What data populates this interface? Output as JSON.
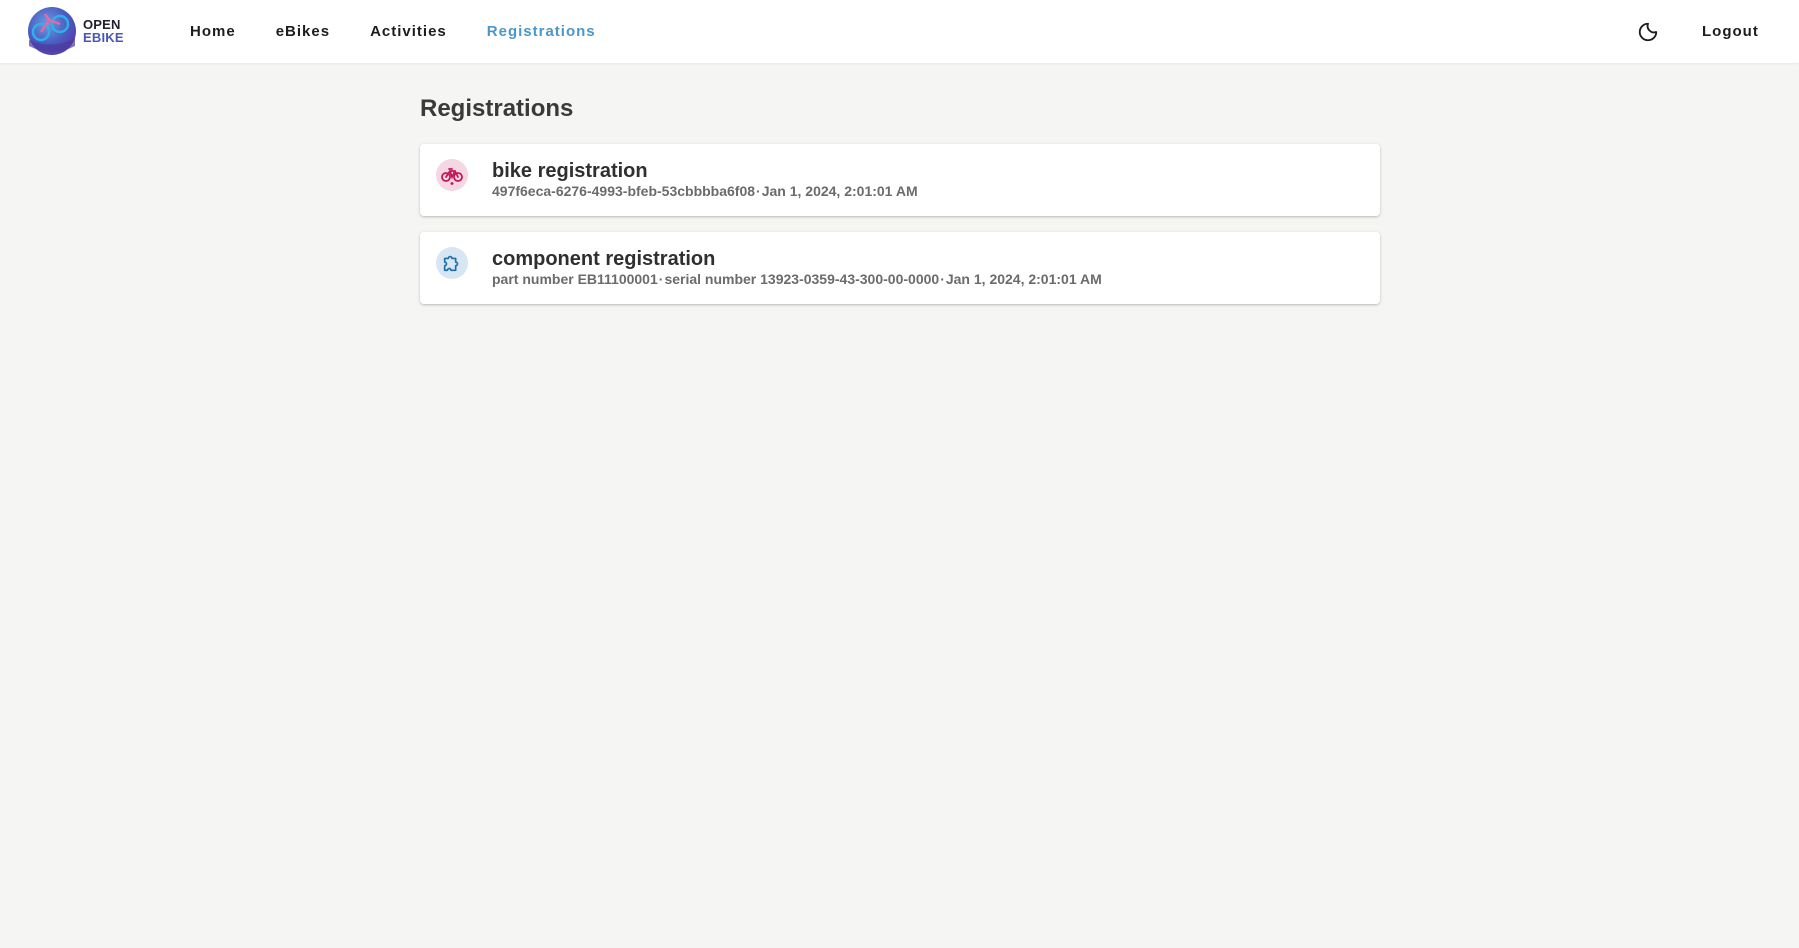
{
  "app": {
    "logo_line1": "OPEN",
    "logo_line2": "EBIKE"
  },
  "nav": {
    "items": [
      {
        "label": "Home"
      },
      {
        "label": "eBikes"
      },
      {
        "label": "Activities"
      },
      {
        "label": "Registrations"
      }
    ],
    "active": "Registrations",
    "logout_label": "Logout",
    "theme_icon": "moon-icon"
  },
  "page": {
    "title": "Registrations"
  },
  "registrations": [
    {
      "title": "bike registration",
      "icon": "bicycle-icon",
      "parts": [
        "497f6eca-6276-4993-bfeb-53cbbbba6f08",
        "Jan 1, 2024, 2:01:01 AM"
      ]
    },
    {
      "title": "component registration",
      "icon": "puzzle-icon",
      "parts": [
        "part number EB11100001",
        "serial number 13923-0359-43-300-00-0000",
        "Jan 1, 2024, 2:01:01 AM"
      ]
    }
  ],
  "colors": {
    "accent": "#4b97c9",
    "background": "#f5f5f4",
    "bike_icon_bg": "#f5d6e3",
    "bike_icon_fg": "#c2185b",
    "component_icon_bg": "#d7e6f2",
    "component_icon_fg": "#1e6fa8"
  }
}
